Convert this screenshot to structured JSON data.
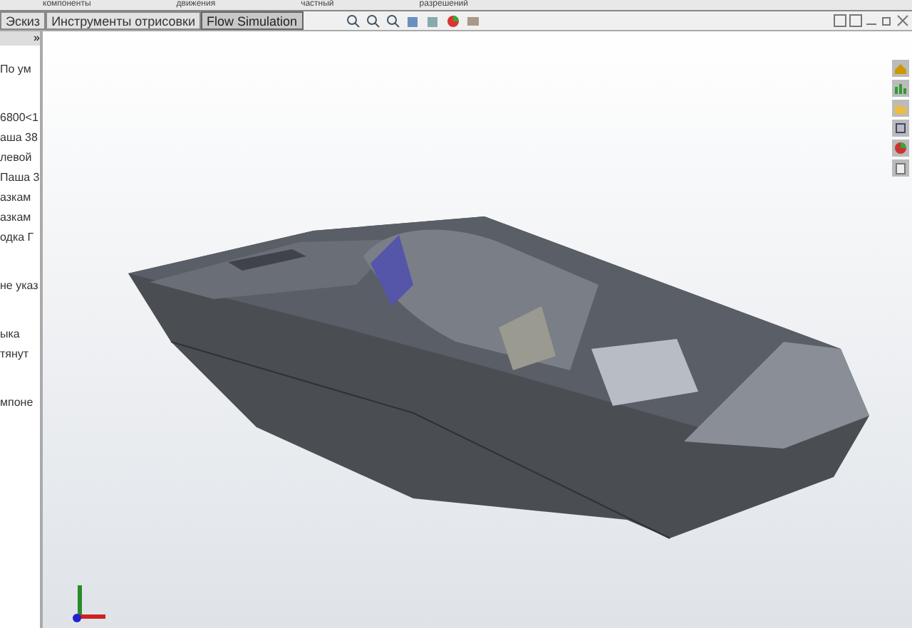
{
  "ribbon_labels": [
    "компоненты",
    "движения",
    "частный",
    "разрешений"
  ],
  "tabs": [
    {
      "label": "Эскиз",
      "selected": false
    },
    {
      "label": "Инструменты отрисовки",
      "selected": false
    },
    {
      "label": "Flow Simulation",
      "selected": true
    }
  ],
  "panel": {
    "collapse": "»",
    "groups": [
      [
        "По ум"
      ],
      [
        "6800<1",
        "аша 38",
        "левой",
        "Паша 3",
        "азкам",
        "азкам",
        "одка Г"
      ],
      [
        "не указ"
      ],
      [
        "ыка",
        "тянут"
      ],
      [
        "мпоне"
      ]
    ]
  }
}
